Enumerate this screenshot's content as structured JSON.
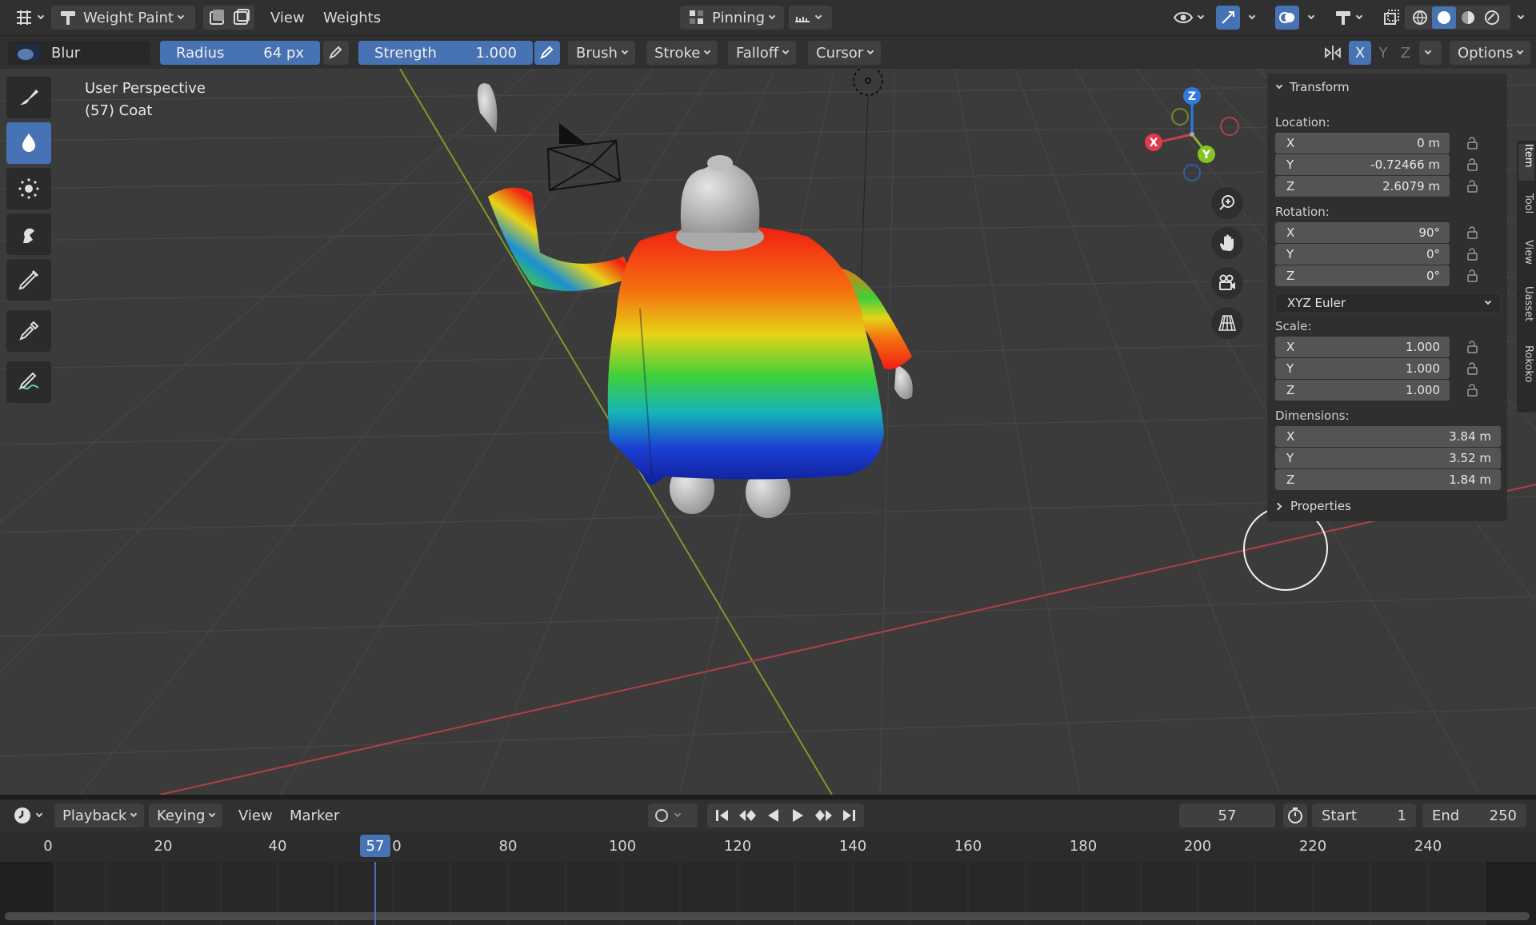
{
  "header": {
    "mode_label": "Weight Paint",
    "menu_view": "View",
    "menu_weights": "Weights",
    "pinning_label": "Pinning"
  },
  "tool_settings": {
    "brush_name": "Blur",
    "radius_label": "Radius",
    "radius_value": "64 px",
    "strength_label": "Strength",
    "strength_value": "1.000",
    "brush_menu": "Brush",
    "stroke_menu": "Stroke",
    "falloff_menu": "Falloff",
    "cursor_menu": "Cursor",
    "axis_x": "X",
    "axis_y": "Y",
    "axis_z": "Z",
    "options_label": "Options"
  },
  "viewport": {
    "perspective_label": "User Perspective",
    "object_label": "(57) Coat",
    "gizmo": {
      "z": "Z",
      "x": "X",
      "y": "Y"
    }
  },
  "n_panel": {
    "transform_header": "Transform",
    "location_label": "Location:",
    "location": [
      {
        "axis": "X",
        "value": "0 m"
      },
      {
        "axis": "Y",
        "value": "-0.72466 m"
      },
      {
        "axis": "Z",
        "value": "2.6079 m"
      }
    ],
    "rotation_label": "Rotation:",
    "rotation": [
      {
        "axis": "X",
        "value": "90°"
      },
      {
        "axis": "Y",
        "value": "0°"
      },
      {
        "axis": "Z",
        "value": "0°"
      }
    ],
    "rotation_mode": "XYZ Euler",
    "scale_label": "Scale:",
    "scale": [
      {
        "axis": "X",
        "value": "1.000"
      },
      {
        "axis": "Y",
        "value": "1.000"
      },
      {
        "axis": "Z",
        "value": "1.000"
      }
    ],
    "dimensions_label": "Dimensions:",
    "dimensions": [
      {
        "axis": "X",
        "value": "3.84 m"
      },
      {
        "axis": "Y",
        "value": "3.52 m"
      },
      {
        "axis": "Z",
        "value": "1.84 m"
      }
    ],
    "properties_header": "Properties",
    "tabs": [
      "Item",
      "Tool",
      "View",
      "Uasset",
      "Rokoko"
    ]
  },
  "timeline": {
    "playback_menu": "Playback",
    "keying_menu": "Keying",
    "view_menu": "View",
    "marker_menu": "Marker",
    "current_frame": "57",
    "start_label": "Start",
    "start_value": "1",
    "end_label": "End",
    "end_value": "250",
    "ruler": [
      "0",
      "20",
      "40",
      "0",
      "80",
      "100",
      "120",
      "140",
      "160",
      "180",
      "200",
      "220",
      "240"
    ],
    "playhead_badge": "57"
  },
  "colors": {
    "accent": "#4772b3",
    "header_bg": "#303030",
    "viewport_bg": "#3b3b3b",
    "axis_red": "#c8414b",
    "axis_green": "#8fb32a",
    "axis_blue": "#2f7ae0"
  }
}
